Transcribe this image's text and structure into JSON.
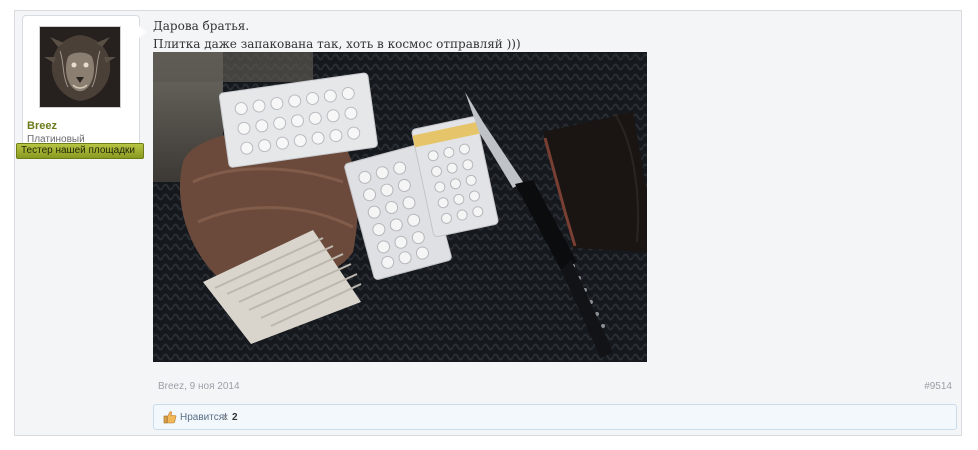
{
  "author": {
    "name": "Breez",
    "rank": "Платиновый",
    "banner": "Тестер нашей площадки"
  },
  "message": {
    "lines": [
      "Дарова братья.",
      "Плитка даже запакована так, хоть в космос отправляй )))"
    ]
  },
  "meta": {
    "author_date": "Breez, 9 ноя 2014",
    "post_number": "#9514"
  },
  "likes": {
    "label": "Нравится!",
    "times": "x",
    "count": "2"
  },
  "colors": {
    "username": "#6c7a1a",
    "banner": "#9aaa2b",
    "frame_bg": "#f4f5f6"
  }
}
